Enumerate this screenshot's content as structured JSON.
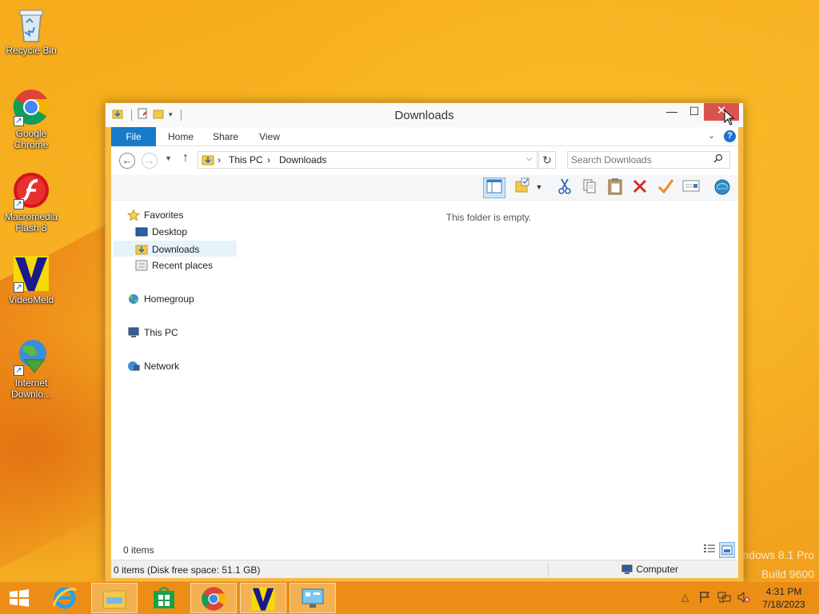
{
  "desktop": {
    "icons": [
      {
        "label": "Recycle Bin",
        "icon": "recycle-bin-icon"
      },
      {
        "label": "Google Chrome",
        "icon": "chrome-icon"
      },
      {
        "label": "Macromedia Flash 8",
        "icon": "flash-icon"
      },
      {
        "label": "VideoMeld",
        "icon": "videomeld-icon"
      },
      {
        "label": "Internet Downlo...",
        "icon": "internet-download-manager-icon"
      }
    ],
    "watermark_line1": "ndows 8.1 Pro",
    "watermark_line2": "Build 9600"
  },
  "window": {
    "title": "Downloads",
    "min_glyph": "—",
    "max_glyph": "☐",
    "close_glyph": "✕"
  },
  "ribbon": {
    "tabs": [
      "File",
      "Home",
      "Share",
      "View"
    ],
    "expand_glyph": "⌄",
    "help_glyph": "?"
  },
  "address": {
    "crumbs": [
      "This PC",
      "Downloads"
    ],
    "separator": "›",
    "search_placeholder": "Search Downloads"
  },
  "nav_pane": {
    "favorites": "Favorites",
    "desktop": "Desktop",
    "downloads": "Downloads",
    "recent": "Recent places",
    "homegroup": "Homegroup",
    "this_pc": "This PC",
    "network": "Network"
  },
  "content": {
    "empty_message": "This folder is empty."
  },
  "items_bar": {
    "count": "0 items"
  },
  "status_bar": {
    "left": "0 items (Disk free space: 51.1 GB)",
    "right": "Computer"
  },
  "taskbar": {
    "time": "4:31 PM",
    "date": "7/18/2023"
  },
  "colors": {
    "ribbon_file_tab": "#1979ca",
    "close_button": "#d9534f",
    "window_frame": "#f6ba47",
    "taskbar": "#ec8c16"
  }
}
